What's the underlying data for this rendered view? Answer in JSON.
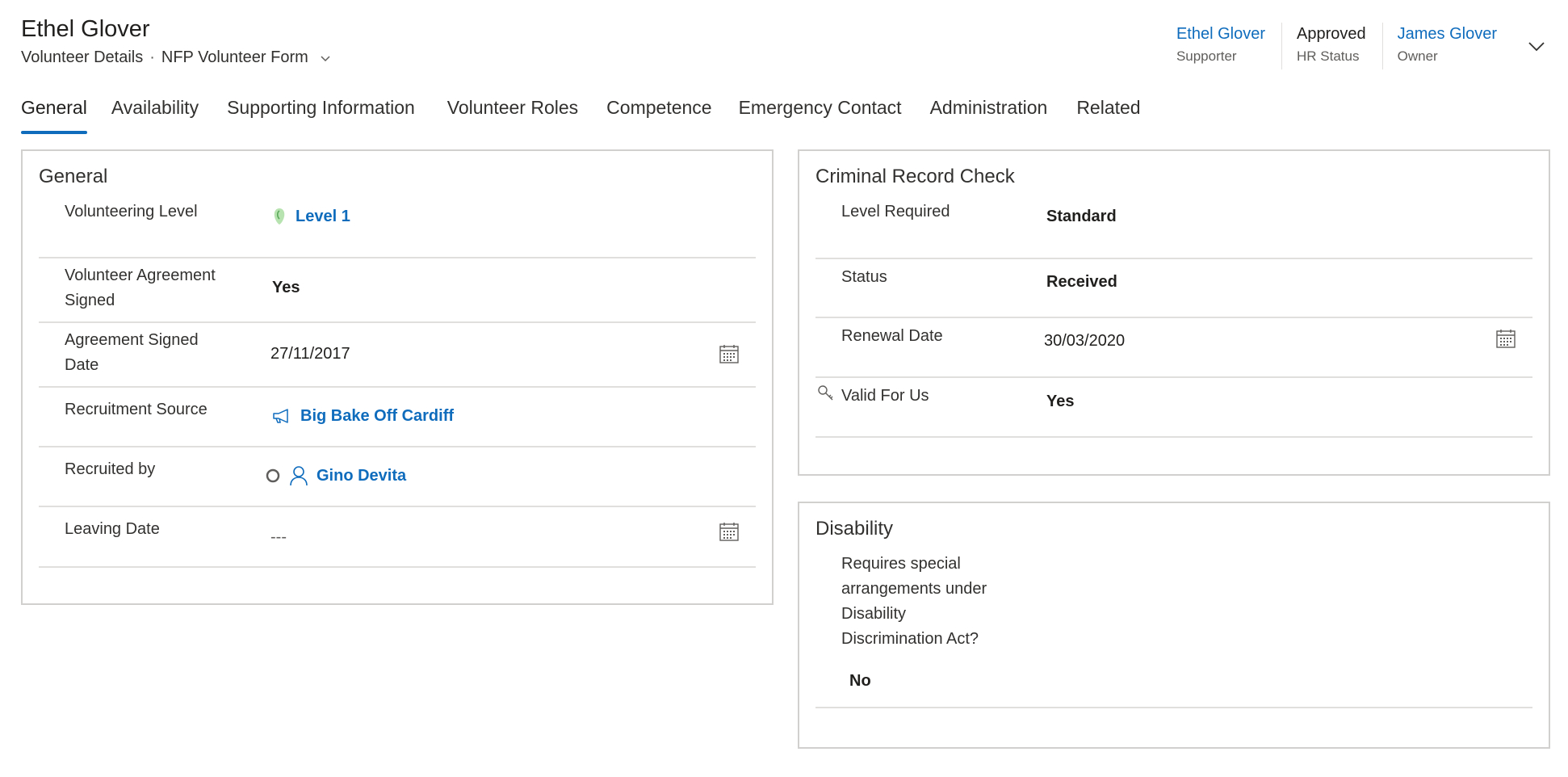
{
  "record": {
    "title": "Ethel Glover",
    "form_section": "Volunteer Details",
    "form_separator": "·",
    "form_name": "NFP Volunteer Form"
  },
  "header_fields": [
    {
      "value": "Ethel Glover",
      "label": "Supporter",
      "link": true
    },
    {
      "value": "Approved",
      "label": "HR Status",
      "link": false
    },
    {
      "value": "James Glover",
      "label": "Owner",
      "link": true
    }
  ],
  "tabs": [
    "General",
    "Availability",
    "Supporting Information",
    "Volunteer Roles",
    "Competence",
    "Emergency Contact",
    "Administration",
    "Related"
  ],
  "active_tab": "General",
  "general": {
    "title": "General",
    "volunteering_level": {
      "label": "Volunteering Level",
      "value": "Level 1",
      "icon": "level-icon"
    },
    "agreement_signed": {
      "label": "Volunteer Agreement Signed",
      "value": "Yes"
    },
    "agreement_date": {
      "label": "Agreement Signed Date",
      "value": "27/11/2017",
      "icon": "calendar-icon"
    },
    "recruitment_source": {
      "label": "Recruitment Source",
      "value": "Big Bake Off Cardiff",
      "icon": "megaphone-icon"
    },
    "recruited_by": {
      "label": "Recruited by",
      "value": "Gino Devita",
      "icon": "person-icon",
      "presence_icon": "presence-offline-icon"
    },
    "leaving_date": {
      "label": "Leaving Date",
      "value": "---",
      "icon": "calendar-icon"
    }
  },
  "criminal_record": {
    "title": "Criminal Record Check",
    "level_required": {
      "label": "Level Required",
      "value": "Standard"
    },
    "status": {
      "label": "Status",
      "value": "Received"
    },
    "renewal_date": {
      "label": "Renewal Date",
      "value": "30/03/2020",
      "icon": "calendar-icon"
    },
    "valid_for_us": {
      "label": "Valid For Us",
      "value": "Yes",
      "icon": "key-icon"
    }
  },
  "disability": {
    "title": "Disability",
    "requires_special": {
      "label": "Requires special arrangements under Disability Discrimination Act?",
      "value": "No"
    }
  },
  "colors": {
    "accent": "#0f6cbd",
    "border": "#d2d0ce",
    "divider": "#e1dfdd",
    "level_icon": "#7fc97f"
  }
}
